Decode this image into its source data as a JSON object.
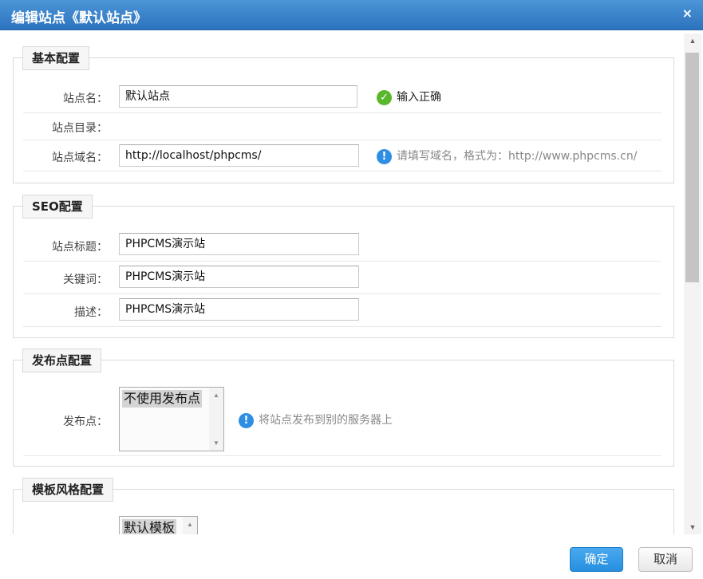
{
  "dialog": {
    "title": "编辑站点《默认站点》",
    "close_glyph": "×"
  },
  "basic": {
    "legend": "基本配置",
    "name_label": "站点名：",
    "name_value": "默认站点",
    "name_tip": "输入正确",
    "dir_label": "站点目录：",
    "domain_label": "站点域名：",
    "domain_value": "http://localhost/phpcms/",
    "domain_tip": "请填写域名，格式为：http://www.phpcms.cn/"
  },
  "seo": {
    "legend": "SEO配置",
    "title_label": "站点标题：",
    "title_value": "PHPCMS演示站",
    "keywords_label": "关键词：",
    "keywords_value": "PHPCMS演示站",
    "desc_label": "描述：",
    "desc_value": "PHPCMS演示站"
  },
  "release": {
    "legend": "发布点配置",
    "point_label": "发布点：",
    "options": [
      "不使用发布点"
    ],
    "tip": "将站点发布到别的服务器上"
  },
  "template": {
    "legend": "模板风格配置",
    "options": [
      "默认模板"
    ]
  },
  "footer": {
    "ok_label": "确定",
    "cancel_label": "取消"
  },
  "icons": {
    "ok": "check-circle-icon",
    "info": "info-circle-icon"
  },
  "colors": {
    "title_bar": "#2c73bf",
    "ok_icon": "#5ab62a",
    "info_icon": "#2e8ee4",
    "primary_button": "#268fde"
  }
}
